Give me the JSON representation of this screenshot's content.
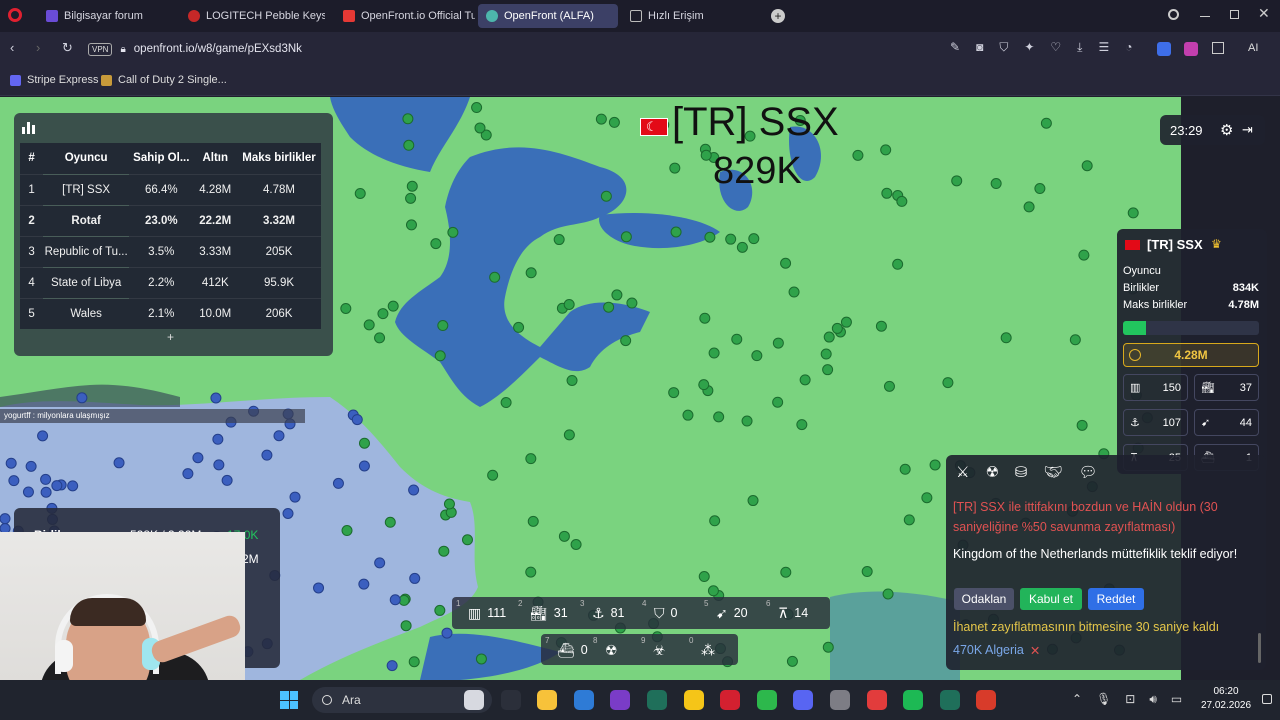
{
  "browser": {
    "tabs": [
      {
        "label": "Bilgisayar forum",
        "color": "#6a4cd6",
        "active": false
      },
      {
        "label": "LOGITECH Pebble Keys 2 K",
        "color": "#c62828",
        "active": false
      },
      {
        "label": "OpenFront.io Official Tuto",
        "color": "#e53935",
        "active": false
      },
      {
        "label": "OpenFront (ALFA)",
        "color": "#4db6ac",
        "active": true
      },
      {
        "label": "Hızlı Erişim",
        "color": "#9e9e9e",
        "active": false
      }
    ],
    "vpn_label": "VPN",
    "url": "openfront.io/w8/game/pEXsd3Nk",
    "ai_label": "AI",
    "bookmarks": [
      "Stripe Express",
      "Call of Duty 2 Single..."
    ]
  },
  "leaderboard": {
    "headers": [
      "#",
      "Oyuncu",
      "Sahip Ol...",
      "Altın",
      "Maks birlikler"
    ],
    "rows": [
      [
        "1",
        "[TR] SSX",
        "66.4%",
        "4.28M",
        "4.78M"
      ],
      [
        "2",
        "Rotaf",
        "23.0%",
        "22.2M",
        "3.32M"
      ],
      [
        "3",
        "Republic of Tu...",
        "3.5%",
        "3.33M",
        "205K"
      ],
      [
        "4",
        "State of Libya",
        "2.2%",
        "412K",
        "95.9K"
      ],
      [
        "5",
        "Wales",
        "2.1%",
        "10.0M",
        "206K"
      ]
    ],
    "bold_row": 1,
    "expand_label": "+"
  },
  "map_label": {
    "name": "[TR] SSX",
    "troops": "829K"
  },
  "chat_line": "yogurtff : milyonlara ulaşmışız",
  "timer": "23:29",
  "player_panel": {
    "name": "[TR] SSX",
    "type_label": "Oyuncu",
    "troops_label": "Birlikler",
    "troops_value": "834K",
    "max_label": "Maks birlikler",
    "max_value": "4.78M",
    "troop_ratio": 0.17,
    "gold": "4.28M",
    "stats": [
      {
        "icon": "city-icon",
        "value": "150"
      },
      {
        "icon": "factory-icon",
        "value": "37"
      },
      {
        "icon": "port-icon",
        "value": "107"
      },
      {
        "icon": "missile-silo-icon",
        "value": "44"
      },
      {
        "icon": "sam-launcher-icon",
        "value": "25"
      },
      {
        "icon": "warship-icon",
        "value": "1"
      }
    ]
  },
  "events": {
    "betrayal": "[TR] SSX ile ittifakını bozdun ve HAİN oldun (30 saniyeliğine %50 savunma zayıflatması)",
    "alliance_request": "Kingdom of the Netherlands müttefiklik teklif ediyor!",
    "focus_label": "Odaklan",
    "accept_label": "Kabul et",
    "reject_label": "Reddet",
    "countdown": "İhanet zayıflatmasının bitmesine 30 saniye kaldı",
    "attack": "470K Algeria"
  },
  "build_bar": [
    {
      "key": "1",
      "icon": "city-icon",
      "value": "111"
    },
    {
      "key": "2",
      "icon": "factory-icon",
      "value": "31"
    },
    {
      "key": "3",
      "icon": "port-icon",
      "value": "81"
    },
    {
      "key": "4",
      "icon": "defense-post-icon",
      "value": "0"
    },
    {
      "key": "5",
      "icon": "missile-silo-icon",
      "value": "20"
    },
    {
      "key": "6",
      "icon": "sam-launcher-icon",
      "value": "14"
    }
  ],
  "build_bar2": [
    {
      "key": "7",
      "icon": "warship-icon",
      "value": "0"
    },
    {
      "key": "8",
      "icon": "atom-bomb-icon",
      "value": ""
    },
    {
      "key": "9",
      "icon": "hydrogen-bomb-icon",
      "value": ""
    },
    {
      "key": "0",
      "icon": "mirv-icon",
      "value": ""
    }
  ],
  "bottom_left_panel": {
    "label": "Birlik",
    "value": "528K / 3.32M",
    "delta": "+17.0K",
    "value2": "2M"
  },
  "taskbar": {
    "search_placeholder": "Ara",
    "time": "06:20",
    "date": "27.02.2026"
  },
  "colors": {
    "land": "#7ad37f",
    "sea": "#3a6fb8",
    "ally_blue": "#9fb6de",
    "gold": "#d8a91c",
    "accept": "#22b45a",
    "reject": "#2f6fe6",
    "betray_text": "#e05252",
    "countdown_text": "#e5c74a"
  }
}
